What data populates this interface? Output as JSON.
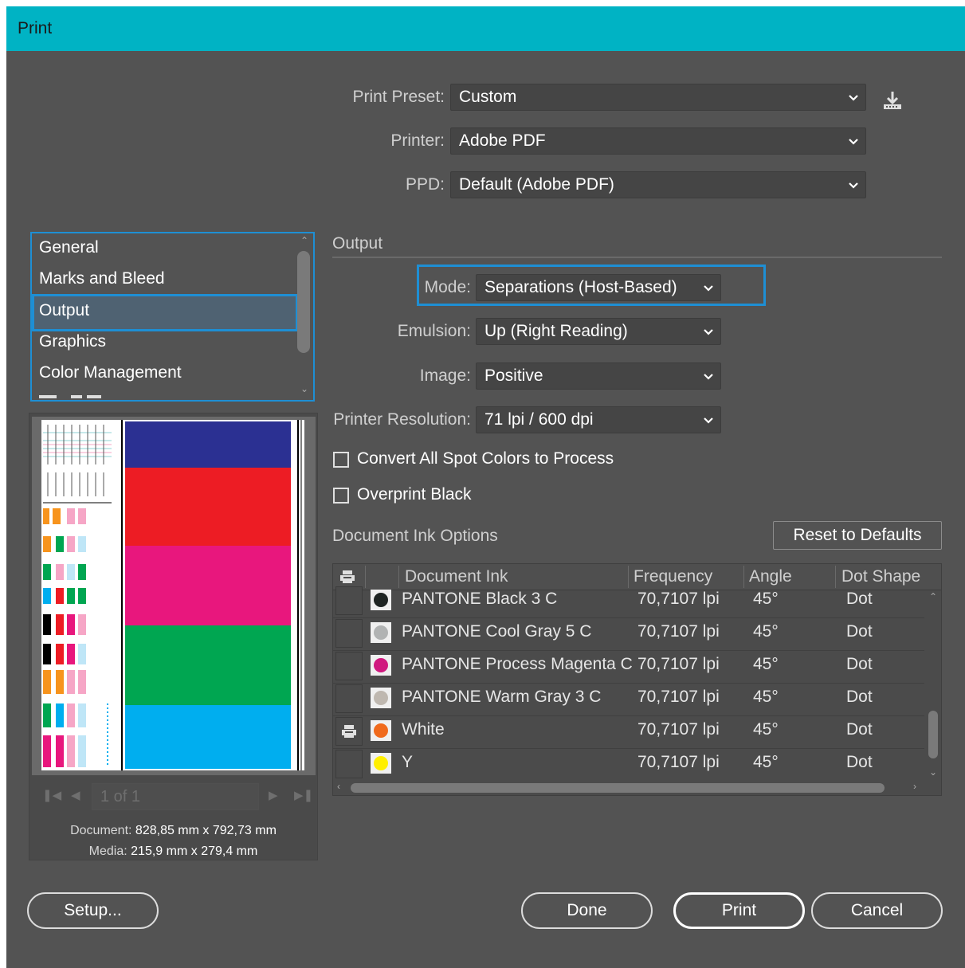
{
  "window": {
    "title": "Print"
  },
  "top": {
    "preset_label": "Print Preset:",
    "preset_value": "Custom",
    "printer_label": "Printer:",
    "printer_value": "Adobe PDF",
    "ppd_label": "PPD:",
    "ppd_value": "Default (Adobe PDF)"
  },
  "sidebar": {
    "items": [
      {
        "label": "General"
      },
      {
        "label": "Marks and Bleed"
      },
      {
        "label": "Output",
        "selected": true
      },
      {
        "label": "Graphics"
      },
      {
        "label": "Color Management"
      }
    ]
  },
  "preview": {
    "page_indicator": "1 of 1",
    "document_label": "Document:",
    "document_value": "828,85 mm x 792,73 mm",
    "media_label": "Media:",
    "media_value": "215,9 mm x 279,4 mm"
  },
  "output": {
    "section_title": "Output",
    "mode_label": "Mode:",
    "mode_value": "Separations (Host-Based)",
    "emulsion_label": "Emulsion:",
    "emulsion_value": "Up (Right Reading)",
    "image_label": "Image:",
    "image_value": "Positive",
    "resolution_label": "Printer Resolution:",
    "resolution_value": "71 lpi / 600 dpi",
    "convert_label": "Convert All Spot Colors to Process",
    "overprint_label": "Overprint Black"
  },
  "inks": {
    "section_title": "Document Ink Options",
    "reset_label": "Reset to Defaults",
    "headers": {
      "ink": "Document Ink",
      "frequency": "Frequency",
      "angle": "Angle",
      "dot": "Dot Shape"
    },
    "rows": [
      {
        "name": "PANTONE Black 3 C",
        "frequency": "70,7107 lpi",
        "angle": "45°",
        "dot": "Dot",
        "color": "#1e2422",
        "print": false
      },
      {
        "name": "PANTONE Cool Gray 5 C",
        "frequency": "70,7107 lpi",
        "angle": "45°",
        "dot": "Dot",
        "color": "#b1b3b3",
        "print": false
      },
      {
        "name": "PANTONE Process Magenta C",
        "frequency": "70,7107 lpi",
        "angle": "45°",
        "dot": "Dot",
        "color": "#d0197f",
        "print": false
      },
      {
        "name": "PANTONE Warm Gray 3 C",
        "frequency": "70,7107 lpi",
        "angle": "45°",
        "dot": "Dot",
        "color": "#bfb8b0",
        "print": false
      },
      {
        "name": "White",
        "frequency": "70,7107 lpi",
        "angle": "45°",
        "dot": "Dot",
        "color": "#f06a1c",
        "print": true
      },
      {
        "name": "Y",
        "frequency": "70,7107 lpi",
        "angle": "45°",
        "dot": "Dot",
        "color": "#ffef00",
        "print": false
      }
    ]
  },
  "buttons": {
    "setup": "Setup...",
    "done": "Done",
    "print": "Print",
    "cancel": "Cancel"
  },
  "colors": {
    "title_bar": "#00b3c4",
    "dialog_bg": "#535353",
    "focus": "#1e8fd4"
  }
}
